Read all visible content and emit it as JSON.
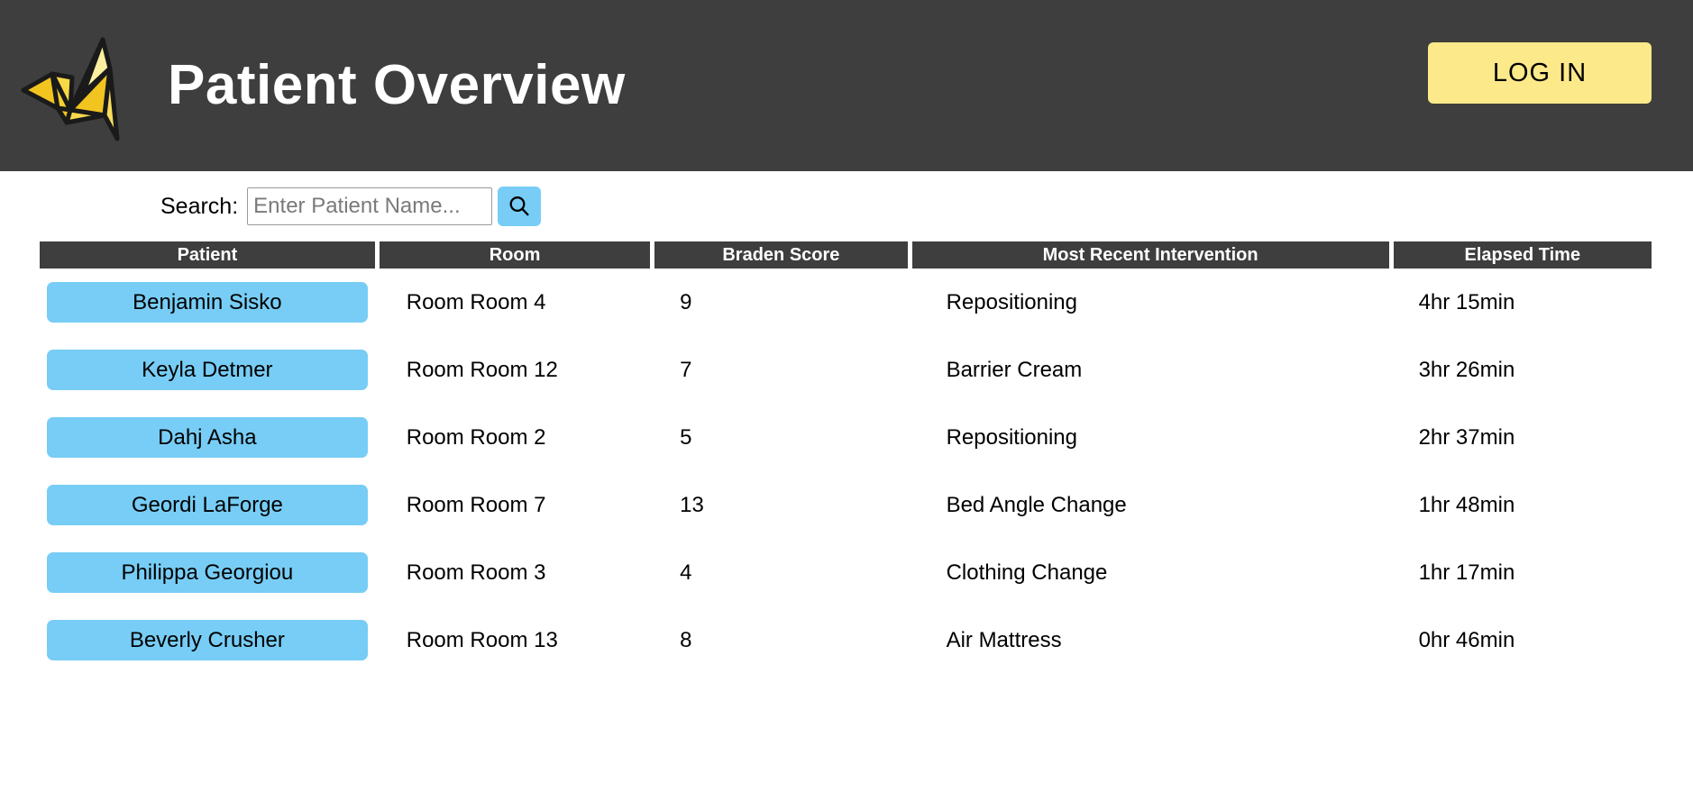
{
  "header": {
    "title": "Patient Overview",
    "logo_icon": "origami-crane-icon",
    "login_label": "LOG IN",
    "background_color": "#3E3E3E",
    "login_color": "#FCE98A"
  },
  "search": {
    "label": "Search:",
    "placeholder": "Enter Patient Name...",
    "value": "",
    "button_icon": "search-icon",
    "button_color": "#77CDF5"
  },
  "table": {
    "columns": [
      "Patient",
      "Room",
      "Braden Score",
      "Most Recent Intervention",
      "Elapsed Time"
    ],
    "accent_color": "#77CDF5",
    "header_color": "#3E3E3E",
    "rows": [
      {
        "patient": "Benjamin Sisko",
        "room": "Room Room 4",
        "braden": "9",
        "intervention": "Repositioning",
        "elapsed": "4hr 15min"
      },
      {
        "patient": "Keyla Detmer",
        "room": "Room Room 12",
        "braden": "7",
        "intervention": "Barrier Cream",
        "elapsed": "3hr 26min"
      },
      {
        "patient": "Dahj Asha",
        "room": "Room Room 2",
        "braden": "5",
        "intervention": "Repositioning",
        "elapsed": "2hr 37min"
      },
      {
        "patient": "Geordi LaForge",
        "room": "Room Room 7",
        "braden": "13",
        "intervention": "Bed Angle Change",
        "elapsed": "1hr 48min"
      },
      {
        "patient": "Philippa Georgiou",
        "room": "Room Room 3",
        "braden": "4",
        "intervention": "Clothing Change",
        "elapsed": "1hr 17min"
      },
      {
        "patient": "Beverly Crusher",
        "room": "Room Room 13",
        "braden": "8",
        "intervention": "Air Mattress",
        "elapsed": "0hr 46min"
      }
    ]
  }
}
